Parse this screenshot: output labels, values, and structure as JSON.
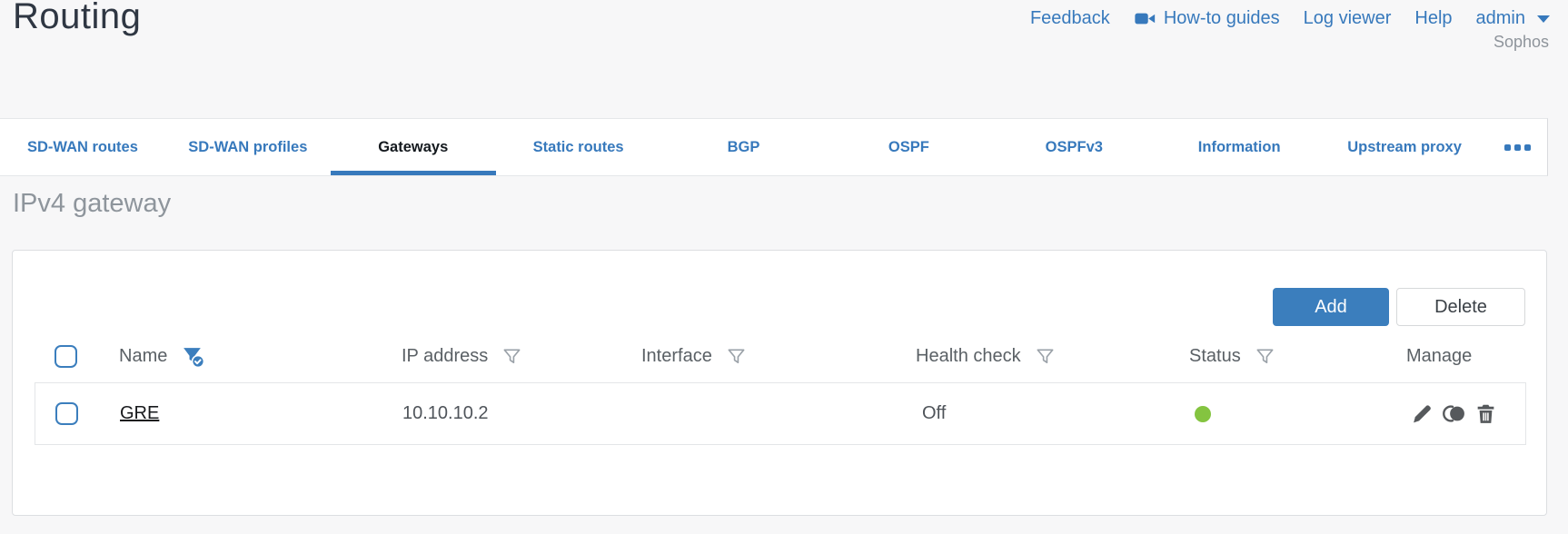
{
  "header": {
    "title": "Routing",
    "org": "Sophos",
    "nav": {
      "feedback": "Feedback",
      "howto_guides": "How-to guides",
      "log_viewer": "Log viewer",
      "help": "Help",
      "user": "admin"
    }
  },
  "tabs": {
    "items": [
      {
        "label": "SD-WAN routes",
        "active": false
      },
      {
        "label": "SD-WAN profiles",
        "active": false
      },
      {
        "label": "Gateways",
        "active": true
      },
      {
        "label": "Static routes",
        "active": false
      },
      {
        "label": "BGP",
        "active": false
      },
      {
        "label": "OSPF",
        "active": false
      },
      {
        "label": "OSPFv3",
        "active": false
      },
      {
        "label": "Information",
        "active": false
      },
      {
        "label": "Upstream proxy",
        "active": false
      }
    ],
    "more": "more-tabs"
  },
  "section": {
    "title": "IPv4 gateway"
  },
  "toolbar": {
    "add_label": "Add",
    "delete_label": "Delete"
  },
  "table": {
    "columns": [
      {
        "label": "Name",
        "filter": "active"
      },
      {
        "label": "IP address",
        "filter": "inactive"
      },
      {
        "label": "Interface",
        "filter": "inactive"
      },
      {
        "label": "Health check",
        "filter": "inactive"
      },
      {
        "label": "Status",
        "filter": "inactive"
      },
      {
        "label": "Manage",
        "filter": "none"
      }
    ],
    "rows": [
      {
        "name": "GRE",
        "ip_address": "10.10.10.2",
        "interface": "",
        "health_check": "Off",
        "status": "up",
        "status_color": "#84c440",
        "manage_actions": [
          "edit",
          "clone",
          "delete"
        ]
      }
    ]
  },
  "colors": {
    "accent_blue": "#3779bc",
    "button_blue": "#3b7ebd",
    "status_green": "#84c440",
    "page_background": "#f7f7f8"
  }
}
